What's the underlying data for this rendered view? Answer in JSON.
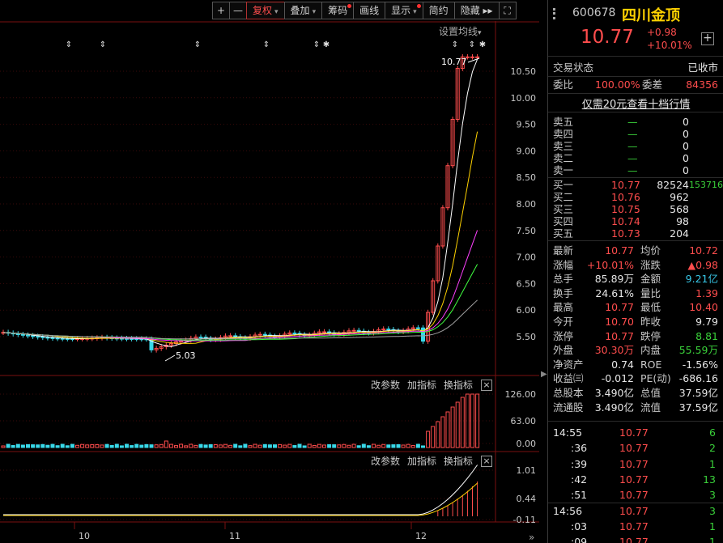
{
  "toolbar": {
    "items": [
      {
        "label": "+",
        "sq": true
      },
      {
        "label": "—",
        "sq": true
      },
      {
        "label": "复权",
        "caret": true,
        "active": true
      },
      {
        "label": "叠加",
        "caret": true
      },
      {
        "label": "筹码",
        "dot": true
      },
      {
        "label": "画线"
      },
      {
        "label": "显示",
        "caret": true,
        "dot": true
      },
      {
        "label": "简约"
      },
      {
        "label": "隐藏 ▸▸"
      },
      {
        "label": "⛶",
        "sq": true
      }
    ]
  },
  "main_chart": {
    "ma_setting_label": "设置均线",
    "high_label": "10.77",
    "low_label": "5.03",
    "y_ticks": [
      "10.50",
      "10.00",
      "9.50",
      "9.00",
      "8.50",
      "8.00",
      "7.50",
      "7.00",
      "6.50",
      "6.00",
      "5.50"
    ],
    "y_values": [
      10.5,
      10.0,
      9.5,
      9.0,
      8.5,
      8.0,
      7.5,
      7.0,
      6.5,
      6.0,
      5.5
    ]
  },
  "vol_panel": {
    "params_label": "改参数",
    "add_indicator_label": "加指标",
    "switch_indicator_label": "换指标",
    "close_label": "×",
    "y_ticks": [
      "126.00",
      "63.00",
      "0.00"
    ]
  },
  "macd_panel": {
    "params_label": "改参数",
    "add_indicator_label": "加指标",
    "switch_indicator_label": "换指标",
    "close_label": "×",
    "y_ticks": [
      "1.01",
      "0.44",
      "-0.11"
    ]
  },
  "x_axis": {
    "labels": [
      "10",
      "11",
      "12"
    ]
  },
  "stock": {
    "code": "600678",
    "name": "四川金顶",
    "price": "10.77",
    "change": "+0.98",
    "change_pct": "+10.01%"
  },
  "trade_status": {
    "label": "交易状态",
    "value": "已收市"
  },
  "ratio": {
    "weibi_label": "委比",
    "weibi_value": "100.00%",
    "weicha_label": "委差",
    "weicha_value": "84356"
  },
  "ten_level_link": "仅需20元查看十档行情",
  "sell_orders": [
    {
      "label": "卖五",
      "price": "—",
      "vol": "0"
    },
    {
      "label": "卖四",
      "price": "—",
      "vol": "0"
    },
    {
      "label": "卖三",
      "price": "—",
      "vol": "0"
    },
    {
      "label": "卖二",
      "price": "—",
      "vol": "0"
    },
    {
      "label": "卖一",
      "price": "—",
      "vol": "0"
    }
  ],
  "buy_orders": [
    {
      "label": "买一",
      "price": "10.77",
      "vol": "82524",
      "extra": "153716"
    },
    {
      "label": "买二",
      "price": "10.76",
      "vol": "962",
      "extra": ""
    },
    {
      "label": "买三",
      "price": "10.75",
      "vol": "568",
      "extra": ""
    },
    {
      "label": "买四",
      "price": "10.74",
      "vol": "98",
      "extra": ""
    },
    {
      "label": "买五",
      "price": "10.73",
      "vol": "204",
      "extra": ""
    }
  ],
  "stats": [
    {
      "l1": "最新",
      "v1": "10.77",
      "c1": "red",
      "l2": "均价",
      "v2": "10.72",
      "c2": "red"
    },
    {
      "l1": "涨幅",
      "v1": "+10.01%",
      "c1": "red",
      "l2": "涨跌",
      "v2": "▲0.98",
      "c2": "red"
    },
    {
      "l1": "总手",
      "v1": "85.89万",
      "c1": "white",
      "l2": "金额",
      "v2": "9.21亿",
      "c2": "cyan"
    },
    {
      "l1": "换手",
      "v1": "24.61%",
      "c1": "white",
      "l2": "量比",
      "v2": "1.39",
      "c2": "red"
    },
    {
      "l1": "最高",
      "v1": "10.77",
      "c1": "red",
      "l2": "最低",
      "v2": "10.40",
      "c2": "red"
    },
    {
      "l1": "今开",
      "v1": "10.70",
      "c1": "red",
      "l2": "昨收",
      "v2": "9.79",
      "c2": "white"
    },
    {
      "l1": "涨停",
      "v1": "10.77",
      "c1": "red",
      "l2": "跌停",
      "v2": "8.81",
      "c2": "green"
    },
    {
      "l1": "外盘",
      "v1": "30.30万",
      "c1": "red",
      "l2": "内盘",
      "v2": "55.59万",
      "c2": "green"
    },
    {
      "l1": "净资产",
      "v1": "0.74",
      "c1": "white",
      "l2": "ROE",
      "v2": "-1.56%",
      "c2": "white"
    },
    {
      "l1": "收益㈢",
      "v1": "-0.012",
      "c1": "white",
      "l2": "PE(动)",
      "v2": "-686.16",
      "c2": "white"
    },
    {
      "l1": "总股本",
      "v1": "3.490亿",
      "c1": "white",
      "l2": "总值",
      "v2": "37.59亿",
      "c2": "white"
    },
    {
      "l1": "流通股",
      "v1": "3.490亿",
      "c1": "white",
      "l2": "流值",
      "v2": "37.59亿",
      "c2": "white"
    }
  ],
  "ticks": [
    {
      "time": "14:55",
      "price": "10.77",
      "vol": "6",
      "major": true
    },
    {
      "time": ":36",
      "price": "10.77",
      "vol": "2",
      "major": false
    },
    {
      "time": ":39",
      "price": "10.77",
      "vol": "1",
      "major": false
    },
    {
      "time": ":42",
      "price": "10.77",
      "vol": "13",
      "major": false
    },
    {
      "time": ":51",
      "price": "10.77",
      "vol": "3",
      "major": false
    },
    {
      "time": "14:56",
      "price": "10.77",
      "vol": "3",
      "major": true
    },
    {
      "time": ":03",
      "price": "10.77",
      "vol": "1",
      "major": false
    },
    {
      "time": ":09",
      "price": "10.77",
      "vol": "1",
      "major": false
    }
  ],
  "colors": {
    "up": "#ff4d4d",
    "down": "#38d8e8",
    "ma5": "#ffffff",
    "ma10": "#ffd200",
    "ma20": "#ff40ff",
    "ma30": "#40ff40",
    "ma60": "#a0a0a0"
  }
}
